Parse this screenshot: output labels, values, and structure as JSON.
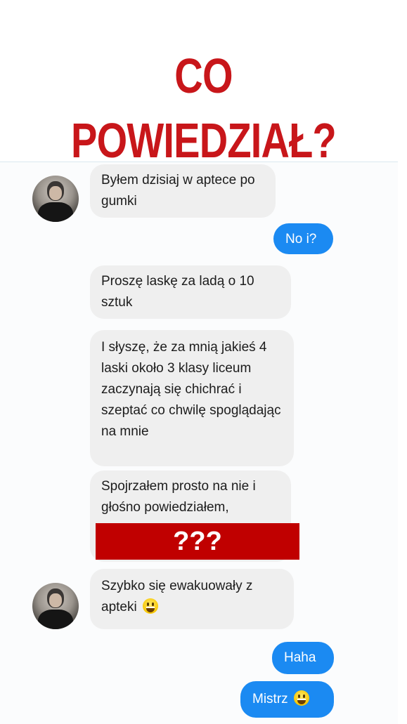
{
  "headline": "CO POWIEDZIAŁ?",
  "messages": [
    {
      "from": "them",
      "text": "Byłem dzisiaj w aptece po gumki"
    },
    {
      "from": "me",
      "text": "No i?"
    },
    {
      "from": "them",
      "text": "Proszę laskę za ladą o 10 sztuk"
    },
    {
      "from": "them",
      "text": "I słyszę, że za mnią jakieś 4 laski około 3 klasy liceum zaczynają się chichrać i szeptać co chwilę spoglądając na mnie"
    },
    {
      "from": "them",
      "text": "Spojrzałem prosto na nie i głośno powiedziałem,"
    },
    {
      "from": "them",
      "text": "Szybko się ewakuowały z apteki",
      "emoji": "grinning-face"
    },
    {
      "from": "me",
      "text": "Haha"
    },
    {
      "from": "me",
      "text": "Mistrz",
      "emoji": "grinning-face"
    }
  ],
  "censor_label": "???",
  "colors": {
    "headline": "#c8161a",
    "incoming_bubble": "#efefef",
    "outgoing_bubble": "#1b8af2",
    "censor_bar": "#c00000"
  }
}
